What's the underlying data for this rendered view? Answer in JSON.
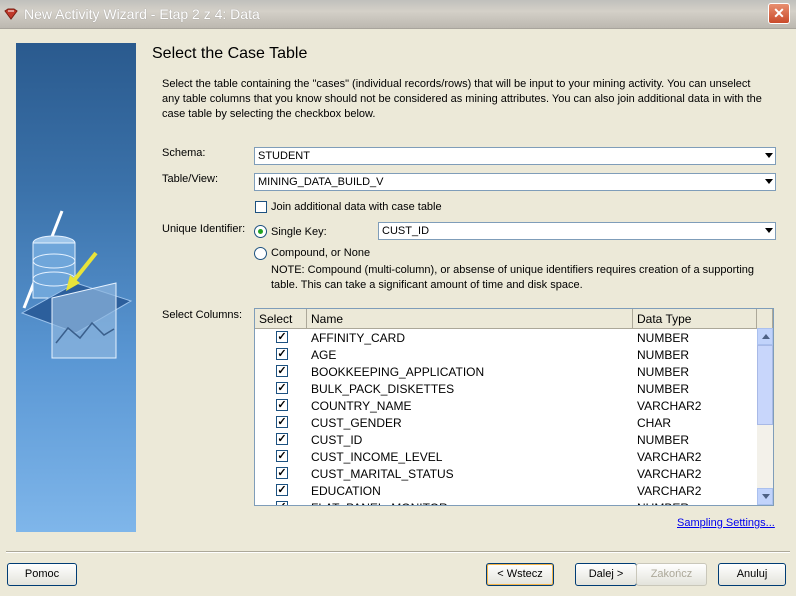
{
  "window": {
    "title": "New Activity Wizard - Etap 2 z 4: Data",
    "close_glyph": "✕"
  },
  "page": {
    "heading": "Select the Case Table",
    "description": "Select the table containing the \"cases\" (individual records/rows) that will be input to your mining activity.  You can unselect any table columns that you know should not be considered as mining attributes.  You can also join additional data in with the case table by selecting the checkbox below."
  },
  "form": {
    "schema_label": "Schema:",
    "schema_value": "STUDENT",
    "table_label": "Table/View:",
    "table_value": "MINING_DATA_BUILD_V",
    "join_label": "Join additional data with case table",
    "join_checked": false,
    "unique_label": "Unique Identifier:",
    "single_key_label": "Single Key:",
    "single_key_selected": true,
    "single_key_value": "CUST_ID",
    "compound_label": "Compound, or None",
    "note": "NOTE: Compound (multi-column), or absense of unique identifiers requires creation of a supporting table. This can take a significant amount of time and disk space.",
    "columns_label": "Select Columns:"
  },
  "table": {
    "headers": [
      "Select",
      "Name",
      "Data Type"
    ],
    "check_glyph": "✓",
    "rows": [
      {
        "name": "AFFINITY_CARD",
        "type": "NUMBER",
        "selected": true
      },
      {
        "name": "AGE",
        "type": "NUMBER",
        "selected": true
      },
      {
        "name": "BOOKKEEPING_APPLICATION",
        "type": "NUMBER",
        "selected": true
      },
      {
        "name": "BULK_PACK_DISKETTES",
        "type": "NUMBER",
        "selected": true
      },
      {
        "name": "COUNTRY_NAME",
        "type": "VARCHAR2",
        "selected": true
      },
      {
        "name": "CUST_GENDER",
        "type": "CHAR",
        "selected": true
      },
      {
        "name": "CUST_ID",
        "type": "NUMBER",
        "selected": true
      },
      {
        "name": "CUST_INCOME_LEVEL",
        "type": "VARCHAR2",
        "selected": true
      },
      {
        "name": "CUST_MARITAL_STATUS",
        "type": "VARCHAR2",
        "selected": true
      },
      {
        "name": "EDUCATION",
        "type": "VARCHAR2",
        "selected": true
      },
      {
        "name": "FLAT_PANEL_MONITOR",
        "type": "NUMBER",
        "selected": true
      }
    ]
  },
  "links": {
    "sampling": "Sampling Settings..."
  },
  "buttons": {
    "help": "Pomoc",
    "back": "< Wstecz",
    "next": "Dalej >",
    "finish": "Zakończ",
    "cancel": "Anuluj"
  },
  "colors": {
    "accent": "#003c74",
    "panel_top": "#2a5a8e",
    "panel_bottom": "#7fb6ea"
  }
}
